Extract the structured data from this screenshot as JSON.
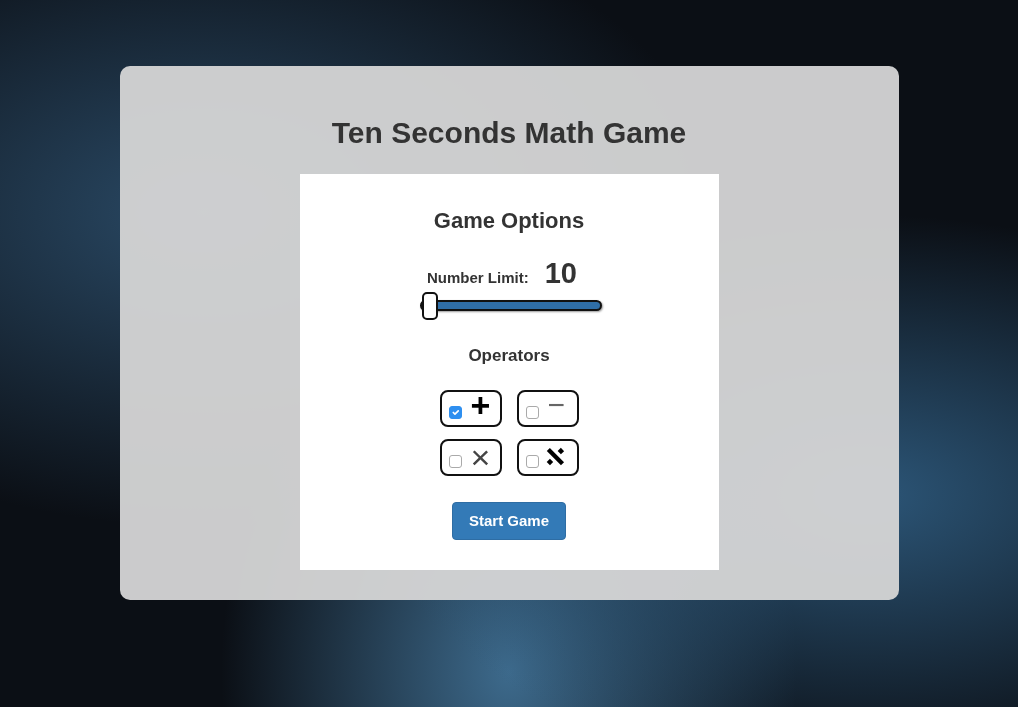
{
  "title": "Ten Seconds Math Game",
  "options": {
    "heading": "Game Options",
    "number_limit": {
      "label": "Number Limit:",
      "value": "10",
      "level": 0
    }
  },
  "operators": {
    "heading": "Operators",
    "items": [
      {
        "kind": "plus",
        "symbol": "+",
        "checked": true
      },
      {
        "kind": "minus",
        "symbol": "−",
        "checked": false
      },
      {
        "kind": "times",
        "symbol": "×",
        "checked": false
      },
      {
        "kind": "divide",
        "symbol": "÷",
        "checked": false
      }
    ]
  },
  "start_button": "Start Game"
}
